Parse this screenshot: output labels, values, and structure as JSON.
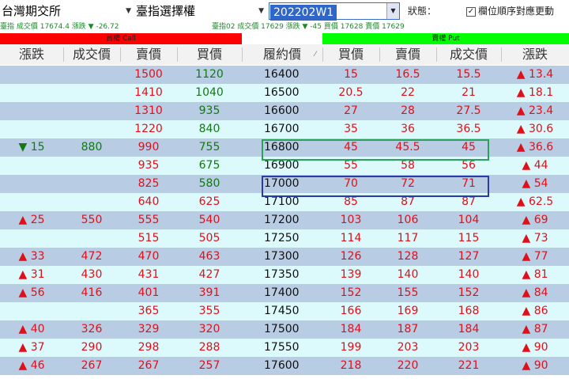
{
  "header": {
    "exchange": "台灣期交所",
    "product": "臺指選擇權",
    "week": "202202W1",
    "status_label": "狀態：",
    "auto_update_label": "欄位順序對應更動",
    "auto_update_checked": true
  },
  "ticker": {
    "left": "臺指  成交價 17674.4  漲跌 ▼ -26.72",
    "right": "臺指02  成交價 17629  漲跌 ▼ -45  買價 17628  賣價 17629"
  },
  "bands": {
    "call": "買權 Call",
    "put": "賣權 Put"
  },
  "columns": [
    "漲跌",
    "成交價",
    "賣價",
    "買價",
    "履約價",
    "買價",
    "賣價",
    "成交價",
    "漲跌"
  ],
  "colors": {
    "row_blue": "#b8cde4",
    "row_cyan": "#dcf9fb",
    "highlight_green": "#2aa35a",
    "highlight_blue": "#2a3aa8"
  },
  "rows": [
    {
      "c_chg": "",
      "c_last": "",
      "c_ask": "1500",
      "c_bid": "1120",
      "strike": "16400",
      "p_bid": "15",
      "p_ask": "16.5",
      "p_last": "15.5",
      "p_chg": "▲ 13.4",
      "c_ask_color": "red",
      "c_bid_color": "green"
    },
    {
      "c_chg": "",
      "c_last": "",
      "c_ask": "1410",
      "c_bid": "1040",
      "strike": "16500",
      "p_bid": "20.5",
      "p_ask": "22",
      "p_last": "21",
      "p_chg": "▲ 18.1",
      "c_ask_color": "red",
      "c_bid_color": "green"
    },
    {
      "c_chg": "",
      "c_last": "",
      "c_ask": "1310",
      "c_bid": "935",
      "strike": "16600",
      "p_bid": "27",
      "p_ask": "28",
      "p_last": "27.5",
      "p_chg": "▲ 23.4",
      "c_ask_color": "red",
      "c_bid_color": "green"
    },
    {
      "c_chg": "",
      "c_last": "",
      "c_ask": "1220",
      "c_bid": "840",
      "strike": "16700",
      "p_bid": "35",
      "p_ask": "36",
      "p_last": "36.5",
      "p_chg": "▲ 30.6",
      "c_ask_color": "red",
      "c_bid_color": "green"
    },
    {
      "c_chg": "▼ 15",
      "c_last": "880",
      "c_ask": "990",
      "c_bid": "755",
      "strike": "16800",
      "p_bid": "45",
      "p_ask": "45.5",
      "p_last": "45",
      "p_chg": "▲ 36.6",
      "c_chg_color": "green",
      "c_last_color": "green",
      "c_ask_color": "red",
      "c_bid_color": "green"
    },
    {
      "c_chg": "",
      "c_last": "",
      "c_ask": "935",
      "c_bid": "675",
      "strike": "16900",
      "p_bid": "55",
      "p_ask": "58",
      "p_last": "56",
      "p_chg": "▲ 44",
      "c_ask_color": "red",
      "c_bid_color": "green"
    },
    {
      "c_chg": "",
      "c_last": "",
      "c_ask": "825",
      "c_bid": "580",
      "strike": "17000",
      "p_bid": "70",
      "p_ask": "72",
      "p_last": "71",
      "p_chg": "▲ 54",
      "c_ask_color": "red",
      "c_bid_color": "green"
    },
    {
      "c_chg": "",
      "c_last": "",
      "c_ask": "640",
      "c_bid": "625",
      "strike": "17100",
      "p_bid": "85",
      "p_ask": "87",
      "p_last": "87",
      "p_chg": "▲ 62.5",
      "c_ask_color": "red",
      "c_bid_color": "red"
    },
    {
      "c_chg": "▲ 25",
      "c_last": "550",
      "c_ask": "555",
      "c_bid": "540",
      "strike": "17200",
      "p_bid": "103",
      "p_ask": "106",
      "p_last": "104",
      "p_chg": "▲ 69",
      "c_chg_color": "red",
      "c_last_color": "red",
      "c_ask_color": "red",
      "c_bid_color": "red"
    },
    {
      "c_chg": "",
      "c_last": "",
      "c_ask": "515",
      "c_bid": "505",
      "strike": "17250",
      "p_bid": "114",
      "p_ask": "117",
      "p_last": "115",
      "p_chg": "▲ 73",
      "c_ask_color": "red",
      "c_bid_color": "red"
    },
    {
      "c_chg": "▲ 33",
      "c_last": "472",
      "c_ask": "470",
      "c_bid": "463",
      "strike": "17300",
      "p_bid": "126",
      "p_ask": "128",
      "p_last": "127",
      "p_chg": "▲ 77",
      "c_chg_color": "red",
      "c_last_color": "red",
      "c_ask_color": "red",
      "c_bid_color": "red"
    },
    {
      "c_chg": "▲ 31",
      "c_last": "430",
      "c_ask": "431",
      "c_bid": "427",
      "strike": "17350",
      "p_bid": "139",
      "p_ask": "140",
      "p_last": "140",
      "p_chg": "▲ 81",
      "c_chg_color": "red",
      "c_last_color": "red",
      "c_ask_color": "red",
      "c_bid_color": "red"
    },
    {
      "c_chg": "▲ 56",
      "c_last": "416",
      "c_ask": "401",
      "c_bid": "391",
      "strike": "17400",
      "p_bid": "152",
      "p_ask": "155",
      "p_last": "152",
      "p_chg": "▲ 84",
      "c_chg_color": "red",
      "c_last_color": "red",
      "c_ask_color": "red",
      "c_bid_color": "red"
    },
    {
      "c_chg": "",
      "c_last": "",
      "c_ask": "365",
      "c_bid": "355",
      "strike": "17450",
      "p_bid": "166",
      "p_ask": "169",
      "p_last": "168",
      "p_chg": "▲ 86",
      "c_ask_color": "red",
      "c_bid_color": "red"
    },
    {
      "c_chg": "▲ 40",
      "c_last": "326",
      "c_ask": "329",
      "c_bid": "320",
      "strike": "17500",
      "p_bid": "184",
      "p_ask": "187",
      "p_last": "184",
      "p_chg": "▲ 87",
      "c_chg_color": "red",
      "c_last_color": "red",
      "c_ask_color": "red",
      "c_bid_color": "red"
    },
    {
      "c_chg": "▲ 37",
      "c_last": "290",
      "c_ask": "298",
      "c_bid": "288",
      "strike": "17550",
      "p_bid": "199",
      "p_ask": "203",
      "p_last": "203",
      "p_chg": "▲ 90",
      "c_chg_color": "red",
      "c_last_color": "red",
      "c_ask_color": "red",
      "c_bid_color": "red"
    },
    {
      "c_chg": "▲ 46",
      "c_last": "267",
      "c_ask": "267",
      "c_bid": "257",
      "strike": "17600",
      "p_bid": "218",
      "p_ask": "220",
      "p_last": "221",
      "p_chg": "▲ 90",
      "c_chg_color": "red",
      "c_last_color": "red",
      "c_ask_color": "red",
      "c_bid_color": "red"
    }
  ]
}
